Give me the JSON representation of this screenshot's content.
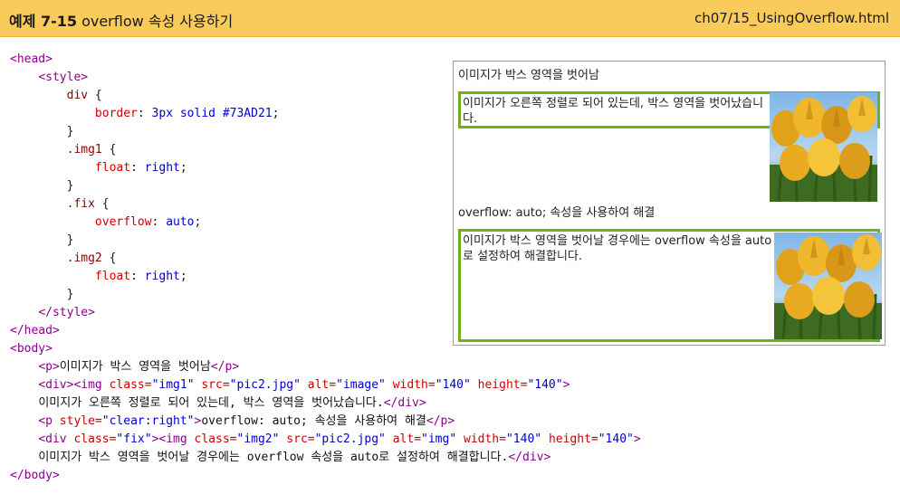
{
  "header": {
    "example_number": "예제 7-15",
    "example_title": "overflow 속성 사용하기",
    "file_path": "ch07/15_UsingOverflow.html"
  },
  "code": {
    "l01": "<head>",
    "l02": "<style>",
    "l03_sel": "div",
    "l04_prop": "border",
    "l04_val": "3px solid #73AD21",
    "l06_sel": ".img1",
    "l07_prop": "float",
    "l07_val": "right",
    "l09_sel": ".fix",
    "l10_prop": "overflow",
    "l10_val": "auto",
    "l12_sel": ".img2",
    "l13_prop": "float",
    "l13_val": "right",
    "l15": "</style>",
    "l16": "</head>",
    "l17": "<body>",
    "l18_open": "<p>",
    "l18_text": "이미지가 박스 영역을 벗어남",
    "l18_close": "</p>",
    "l19_div": "<div>",
    "l19_img": "<img",
    "l19_attr_class": "class=",
    "l19_class": "\"img1\"",
    "l19_attr_src": "src=",
    "l19_src": "\"pic2.jpg\"",
    "l19_attr_alt": "alt=",
    "l19_alt": "\"image\"",
    "l19_attr_width": "width=",
    "l19_width": "\"140\"",
    "l19_attr_height": "height=",
    "l19_height": "\"140\"",
    "l19_end": ">",
    "l20_text": "이미지가 오른쪽 정렬로 되어 있는데, 박스 영역을 벗어났습니다.",
    "l20_close": "</div>",
    "l21_open": "<p",
    "l21_attr_style": "style=",
    "l21_style": "\"clear:right\"",
    "l21_gt": ">",
    "l21_text": "overflow: auto; 속성을 사용하여 해결",
    "l21_close": "</p>",
    "l22_div": "<div",
    "l22_attr_class": "class=",
    "l22_class": "\"fix\"",
    "l22_gt": ">",
    "l22_img": "<img",
    "l22_attr_class2": "class=",
    "l22_class2": "\"img2\"",
    "l22_attr_src": "src=",
    "l22_src": "\"pic2.jpg\"",
    "l22_attr_alt": "alt=",
    "l22_alt": "\"img\"",
    "l22_attr_width": "width=",
    "l22_width": "\"140\"",
    "l22_attr_height": "height=",
    "l22_height": "\"140\"",
    "l22_end": ">",
    "l23_text": "이미지가 박스 영역을 벗어날 경우에는 overflow 속성을 auto로 설정하여 해결합니다.",
    "l23_close": "</div>",
    "l24": "</body>"
  },
  "preview": {
    "p1": "이미지가 박스 영역을 벗어남",
    "div1_text": "이미지가 오른쪽 정렬로 되어 있는데, 박스 영역을 벗어났습니다.",
    "p2": "overflow: auto; 속성을 사용하여 해결",
    "div2_text": "이미지가 박스 영역을 벗어날 경우에는 overflow 속성을 auto로 설정하여 해결합니다.",
    "border_color": "#73AD21",
    "image1_icon": "tulip-photo",
    "image2_icon": "tulip-photo"
  }
}
